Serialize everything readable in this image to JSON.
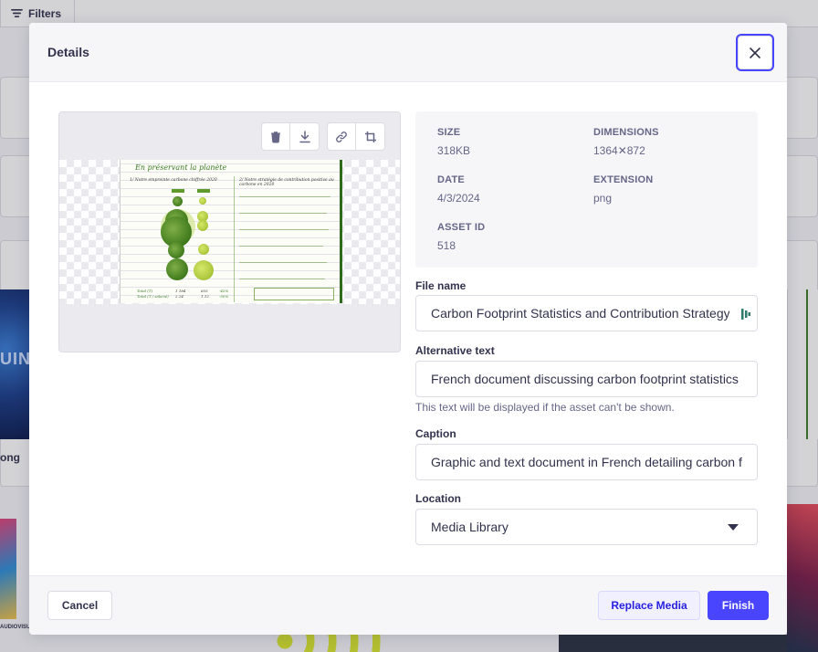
{
  "background": {
    "filters_label": "Filters",
    "thumb_text": "UIN",
    "left_caption": "ong",
    "small_text": "AUDIOVISU"
  },
  "modal": {
    "title": "Details",
    "close_icon": "close-icon"
  },
  "preview": {
    "tools": [
      "trash-icon",
      "download-icon",
      "link-icon",
      "crop-icon"
    ],
    "document": {
      "title": "En préservant la planète",
      "left_heading": "1/ Notre empreinte carbone chiffrée 2020",
      "right_heading": "2/ Notre stratégie de contribution positive au carbone en 2020",
      "total_a": "Total (T)",
      "total_b": "Total (T / salarié)",
      "val_1": "1 184",
      "val_2": "2.24",
      "val_3": "655",
      "val_4": "1.12",
      "pct_1": "-45%",
      "pct_2": "-50%"
    }
  },
  "info": {
    "size_label": "SIZE",
    "size_value": "318KB",
    "dimensions_label": "DIMENSIONS",
    "dimensions_value": "1364✕872",
    "date_label": "DATE",
    "date_value": "4/3/2024",
    "extension_label": "EXTENSION",
    "extension_value": "png",
    "asset_id_label": "ASSET ID",
    "asset_id_value": "518"
  },
  "form": {
    "file_name_label": "File name",
    "file_name_value": "Carbon Footprint Statistics and Contribution Strategy",
    "alt_text_label": "Alternative text",
    "alt_text_value": "French document discussing carbon footprint statistics",
    "alt_text_hint": "This text will be displayed if the asset can't be shown.",
    "caption_label": "Caption",
    "caption_value": "Graphic and text document in French detailing carbon footprint",
    "location_label": "Location",
    "location_value": "Media Library"
  },
  "footer": {
    "cancel_label": "Cancel",
    "replace_label": "Replace Media",
    "finish_label": "Finish"
  },
  "colors": {
    "primary": "#4945ff",
    "text": "#32324d",
    "muted": "#666687"
  }
}
